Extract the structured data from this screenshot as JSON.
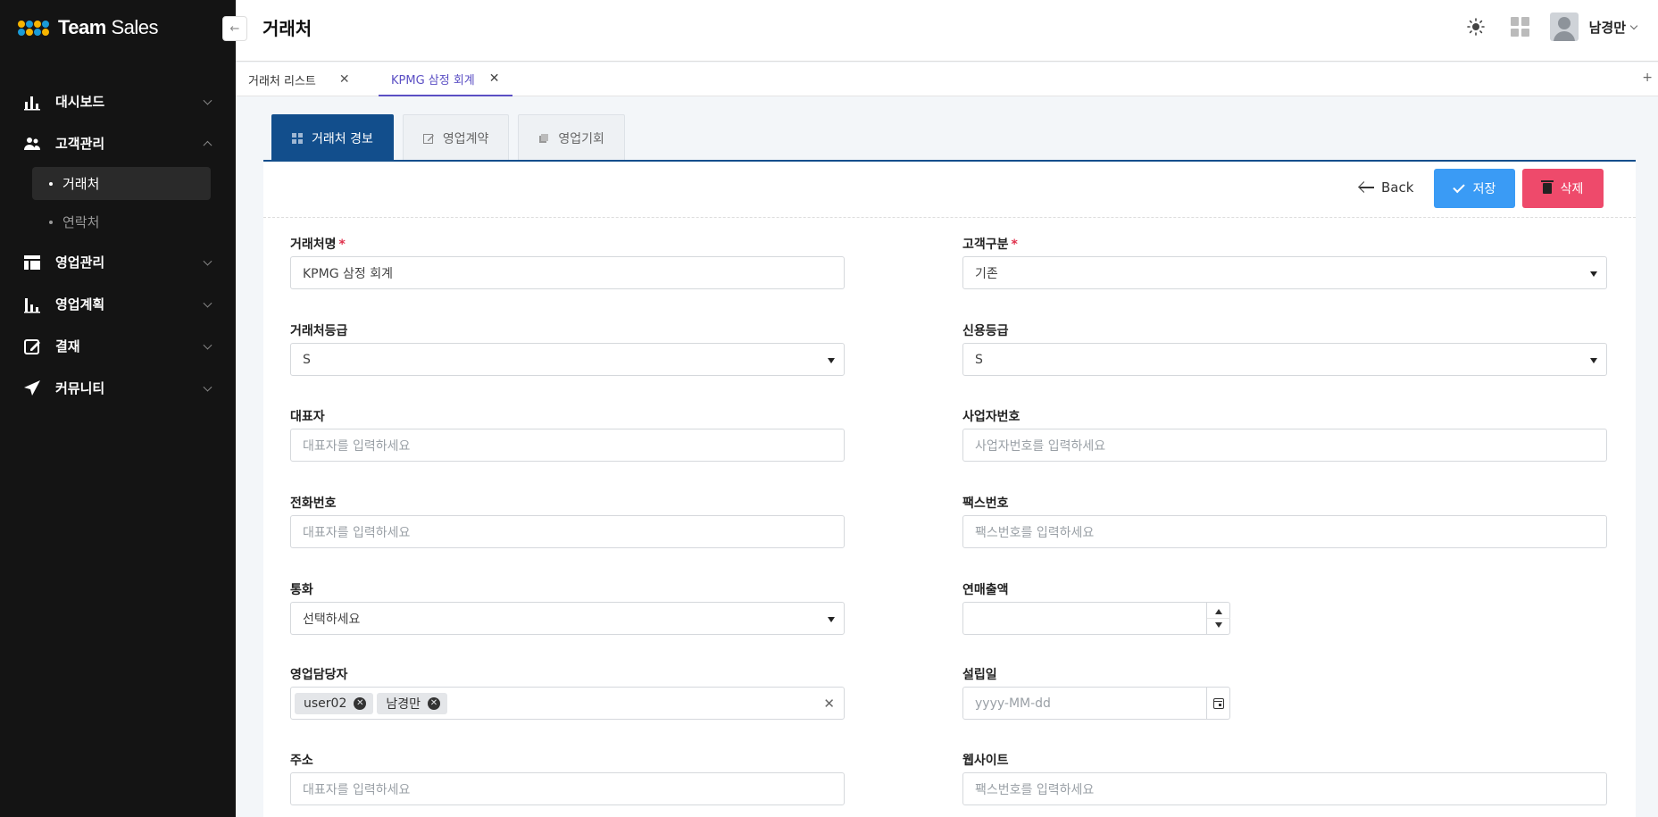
{
  "app": {
    "logo_bold": "Team",
    "logo_light": " Sales",
    "logo_dot_colors": [
      "#f5b400",
      "#1a9bd7",
      "#f5b400",
      "#1a9bd7",
      "#1a9bd7",
      "#f5b400",
      "#1a9bd7",
      "#f5b400"
    ],
    "collapse_icon": "←"
  },
  "sidebar": {
    "items": [
      {
        "label": "대시보드",
        "icon": "bar-chart-icon",
        "expanded": false
      },
      {
        "label": "고객관리",
        "icon": "users-icon",
        "expanded": true,
        "children": [
          {
            "label": "거래처",
            "active": true
          },
          {
            "label": "연락처",
            "active": false
          }
        ]
      },
      {
        "label": "영업관리",
        "icon": "layout-icon",
        "expanded": false
      },
      {
        "label": "영업계획",
        "icon": "chart-plan-icon",
        "expanded": false
      },
      {
        "label": "결재",
        "icon": "edit-icon",
        "expanded": false
      },
      {
        "label": "커뮤니티",
        "icon": "send-icon",
        "expanded": false
      }
    ]
  },
  "header": {
    "title": "거래처",
    "user_name": "남경만"
  },
  "doc_tabs": [
    {
      "label": "거래처 리스트",
      "close": "✕",
      "active": false
    },
    {
      "label": "KPMG 삼정 회계",
      "close": "✕",
      "active": true
    }
  ],
  "add_tab_icon": "+",
  "sub_tabs": [
    {
      "label": "거래처 경보",
      "active": true
    },
    {
      "label": "영업계약",
      "active": false
    },
    {
      "label": "영업기회",
      "active": false
    }
  ],
  "actions": {
    "back": "Back",
    "save": "저장",
    "delete": "삭제"
  },
  "form": {
    "name": {
      "label": "거래처명",
      "required": "*",
      "value": "KPMG 삼정 회계"
    },
    "customer_type": {
      "label": "고객구분",
      "required": "*",
      "value": "기존"
    },
    "grade": {
      "label": "거래처등급",
      "value": "S"
    },
    "credit_grade": {
      "label": "신용등급",
      "value": "S"
    },
    "ceo": {
      "label": "대표자",
      "placeholder": "대표자를 입력하세요"
    },
    "business_no": {
      "label": "사업자번호",
      "placeholder": "사업자번호를 입력하세요"
    },
    "phone": {
      "label": "전화번호",
      "placeholder": "대표자를 입력하세요"
    },
    "fax": {
      "label": "팩스번호",
      "placeholder": "팩스번호를 입력하세요"
    },
    "currency": {
      "label": "통화",
      "value": "선택하세요"
    },
    "annual_sales": {
      "label": "연매출액",
      "value": ""
    },
    "sales_rep": {
      "label": "영업담당자",
      "chips": [
        "user02",
        "남경만"
      ],
      "clear": "✕"
    },
    "founded": {
      "label": "설립일",
      "placeholder": "yyyy-MM-dd"
    },
    "address": {
      "label": "주소",
      "placeholder": "대표자를 입력하세요"
    },
    "website": {
      "label": "웹사이트",
      "placeholder": "팩스번호를 입력하세요"
    }
  }
}
